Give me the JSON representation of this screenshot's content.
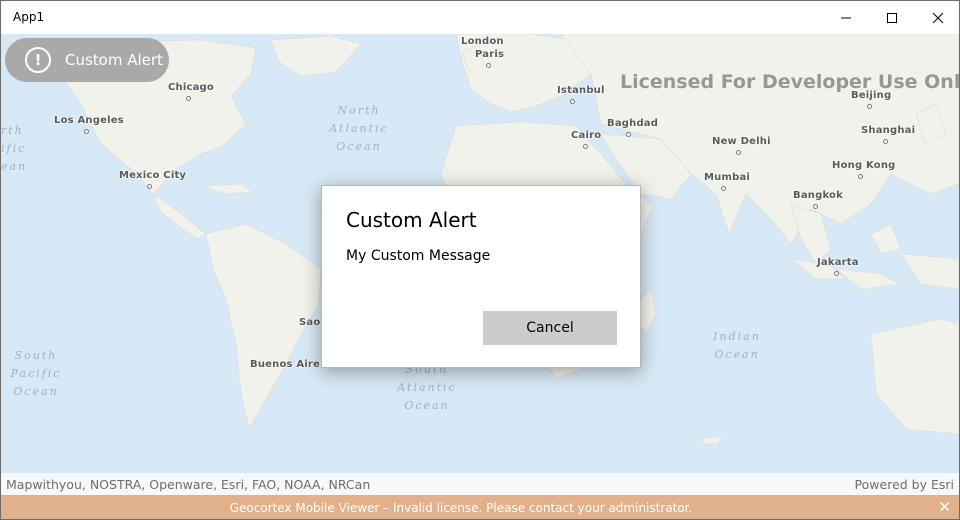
{
  "window": {
    "title": "App1"
  },
  "alert_button": {
    "icon": "exclamation-circle-icon",
    "label": "Custom Alert"
  },
  "map": {
    "watermark": "Licensed For Developer Use Only",
    "places": {
      "london": "London",
      "paris": "Paris",
      "chicago": "Chicago",
      "los_angeles": "Los Angeles",
      "mexico_city": "Mexico City",
      "istanbul": "Istanbul",
      "cairo": "Cairo",
      "baghdad": "Baghdad",
      "new_delhi": "New Delhi",
      "mumbai": "Mumbai",
      "beijing": "Beijing",
      "shanghai": "Shanghai",
      "hong_kong": "Hong Kong",
      "bangkok": "Bangkok",
      "jakarta": "Jakarta",
      "sao": "Sao",
      "buenos_aires": "Buenos Aire"
    },
    "oceans": {
      "north_atlantic": "North\nAtlantic\nOcean",
      "south_pacific": "South\nPacific\nOcean",
      "south_atlantic": "South\nAtlantic\nOcean",
      "indian": "Indian\nOcean",
      "north_pacific_partial": "rth\nific\nean"
    },
    "colors": {
      "ocean": "#d7e9f6",
      "land": "#f2f2ec"
    }
  },
  "attribution": {
    "sources": "Mapwithyou, NOSTRA, Openware, Esri, FAO, NOAA, NRCan",
    "powered_by": "Powered by Esri"
  },
  "license_bar": {
    "message": "Geocortex Mobile Viewer – Invalid license. Please contact your administrator.",
    "close_icon": "close-icon",
    "color": "#e2b08a"
  },
  "dialog": {
    "title": "Custom Alert",
    "message": "My Custom Message",
    "cancel_label": "Cancel"
  }
}
